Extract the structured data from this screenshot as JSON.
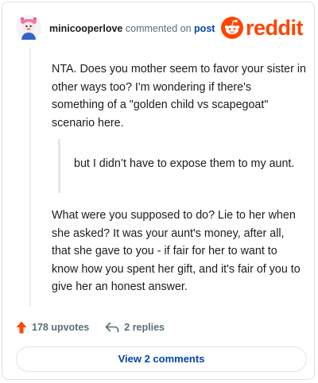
{
  "header": {
    "username": "minicooperlove",
    "action": "commented on",
    "post_link": "post",
    "logo_text": "reddit"
  },
  "comment": {
    "paragraph1": "NTA. Does you mother seem to favor your sister in other ways too? I'm wondering if there's something of a \"golden child vs scapegoat\" scenario here.",
    "quote": "but I didn’t have to expose them to my aunt.",
    "paragraph2": "What were you supposed to do? Lie to her when she asked? It was your aunt's money, after all, that she gave to you - if fair for her to want to know how you spent her gift, and it's fair of you to give her an honest answer."
  },
  "actions": {
    "upvotes": "178 upvotes",
    "replies": "2 replies"
  },
  "footer": {
    "view_comments": "View 2 comments"
  },
  "colors": {
    "brand": "#ff4500",
    "link": "#0045ac",
    "muted": "#576f76"
  },
  "icons": [
    "avatar-icon",
    "reddit-snoo-icon",
    "upvote-arrow-icon",
    "reply-arrow-icon"
  ]
}
